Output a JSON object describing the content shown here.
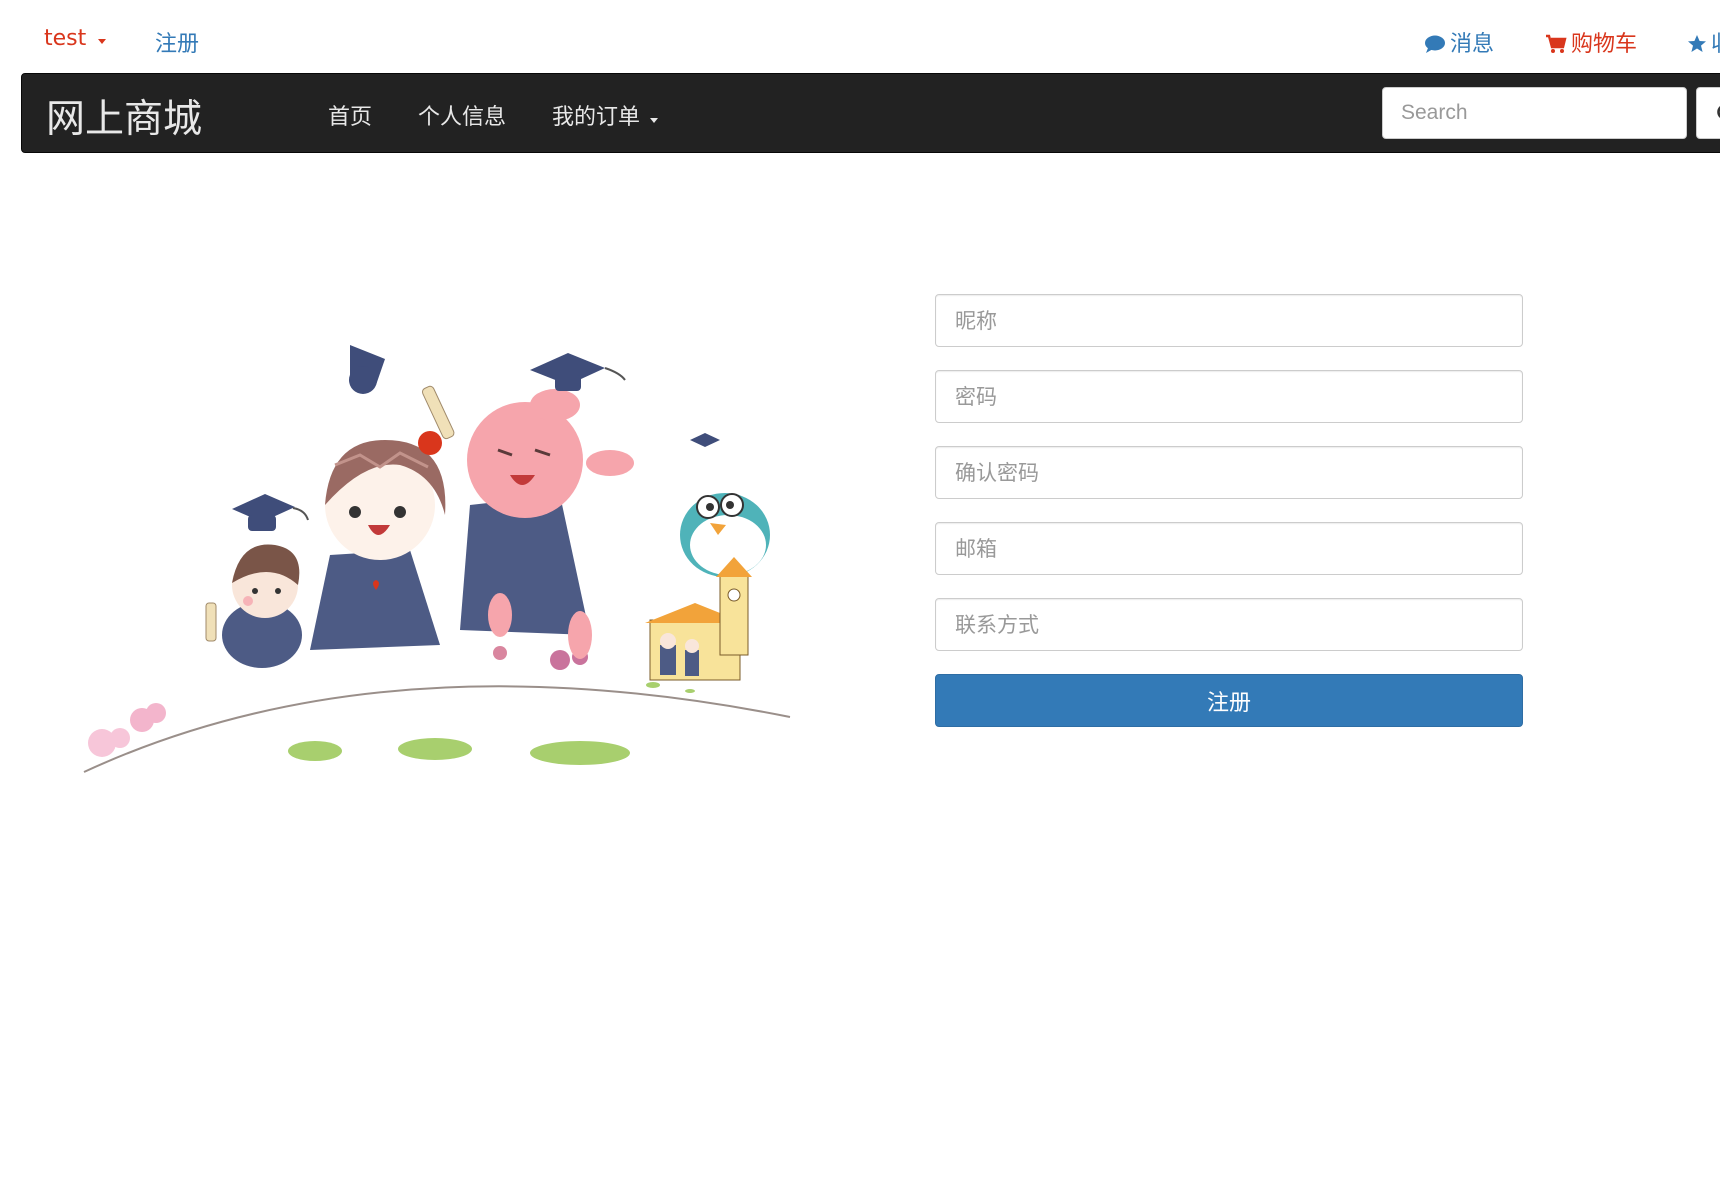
{
  "topbar": {
    "user": "test",
    "register": "注册",
    "messages": "消息",
    "cart": "购物车",
    "favorites": "收"
  },
  "navbar": {
    "brand": "网上商城",
    "home": "首页",
    "profile": "个人信息",
    "orders": "我的订单",
    "search_placeholder": "Search"
  },
  "form": {
    "nickname_placeholder": "昵称",
    "password_placeholder": "密码",
    "confirm_password_placeholder": "确认密码",
    "email_placeholder": "邮箱",
    "contact_placeholder": "联系方式",
    "submit": "注册"
  },
  "colors": {
    "navbar_bg": "#222222",
    "primary": "#337ab7",
    "accent_red": "#d9361c"
  },
  "icons": [
    "comment-icon",
    "cart-icon",
    "star-icon",
    "search-icon",
    "caret-down-icon"
  ]
}
